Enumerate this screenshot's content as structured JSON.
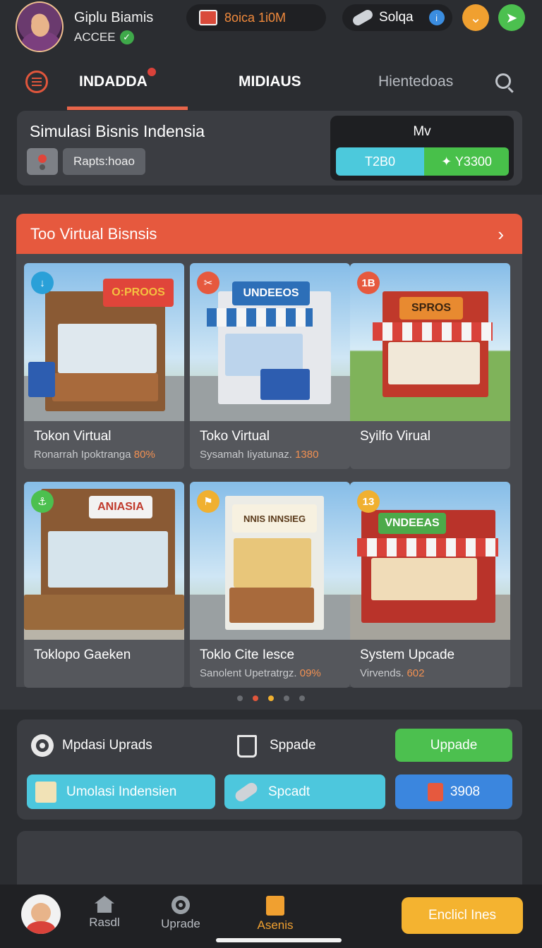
{
  "user": {
    "name": "Giplu Biamis",
    "status": "ACCEE"
  },
  "topbar": {
    "coin_value": "8oica 1i0M",
    "sol_label": "Solqa"
  },
  "tabs": [
    {
      "label": "INDADDA"
    },
    {
      "label": "MIDIAUS"
    },
    {
      "label": "Hientedoas"
    }
  ],
  "header": {
    "title": "Simulasi Bisnis Indensia",
    "tag": "Rapts:hoao",
    "stat_label": "Mv",
    "stat_left": "T2B0",
    "stat_right": "✦ Y3300"
  },
  "section": {
    "title": "Too Virtual Bisnsis"
  },
  "cards": [
    {
      "title": "Tokon Virtual",
      "sub": "Ronarrah Ipoktranga",
      "value": "80%",
      "badge": "↓",
      "sign": "O:PROOS"
    },
    {
      "title": "Toko Virtual",
      "sub": "Sysamah Iiyatunaz.",
      "value": "1380",
      "badge": "✂",
      "sign": "UNDEEOS"
    },
    {
      "title": "Syilfo Virual",
      "sub": "",
      "value": "",
      "badge": "1B",
      "sign": "SPROS"
    },
    {
      "title": "Toklopo Gaeken",
      "sub": "",
      "value": "",
      "badge": "⚓",
      "sign": "ANIASIA"
    },
    {
      "title": "Toklo Cite Iesce",
      "sub": "Sanolent Upetratrgz.",
      "value": "09%",
      "badge": "⚑",
      "sign": "NNIS INNSIEG"
    },
    {
      "title": "System Upcade",
      "sub": "Virvends.",
      "value": "602",
      "badge": "13",
      "sign": "VNDEEAS"
    }
  ],
  "panel": {
    "label1": "Mpdasi Uprads",
    "label2": "Sppade",
    "upgrade_btn": "Uppade",
    "cyan_btn1": "Umolasi Indensien",
    "cyan_btn2": "Spcadt",
    "blue_btn": "3908"
  },
  "nav": {
    "home": "Rasdl",
    "upgrade": "Uprade",
    "bisnis": "Asenis",
    "cta": "Enclicl Ines"
  },
  "colors": {
    "accent": "#e6593e",
    "green": "#4cc04f",
    "cyan": "#4dc7dd",
    "blue": "#3b86de",
    "yellow": "#f4b330"
  }
}
